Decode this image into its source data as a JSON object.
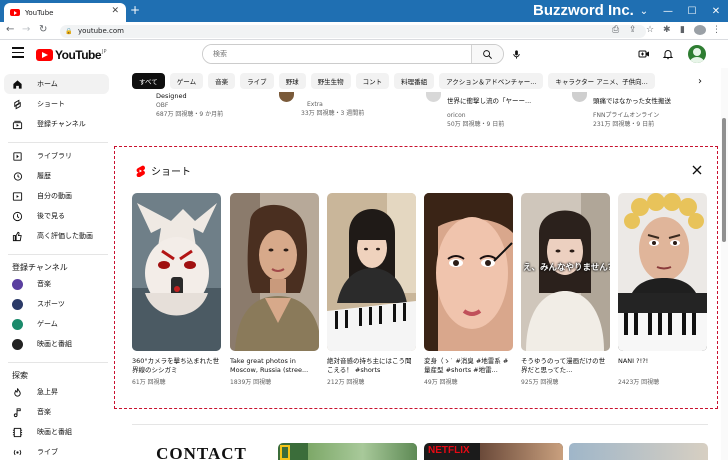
{
  "browser": {
    "tab_title": "YouTube",
    "url": "youtube.com",
    "brand_text": "Buzzword Inc."
  },
  "header": {
    "logo_text": "YouTube",
    "logo_suffix": "JP",
    "search_placeholder": "検索"
  },
  "sidebar": {
    "main": [
      {
        "label": "ホーム",
        "icon": "home-icon"
      },
      {
        "label": "ショート",
        "icon": "shorts-icon"
      },
      {
        "label": "登録チャンネル",
        "icon": "subscriptions-icon"
      }
    ],
    "library": [
      {
        "label": "ライブラリ",
        "icon": "library-icon"
      },
      {
        "label": "履歴",
        "icon": "history-icon"
      },
      {
        "label": "自分の動画",
        "icon": "my-videos-icon"
      },
      {
        "label": "後で見る",
        "icon": "watch-later-icon"
      },
      {
        "label": "高く評価した動画",
        "icon": "liked-icon"
      }
    ],
    "subs_heading": "登録チャンネル",
    "subs": [
      {
        "label": "音楽",
        "color": "#5a3fa0"
      },
      {
        "label": "スポーツ",
        "color": "#2b3a67"
      },
      {
        "label": "ゲーム",
        "color": "#1b8a6b"
      },
      {
        "label": "映画と番組",
        "color": "#222222"
      }
    ],
    "explore_heading": "探索",
    "explore": [
      {
        "label": "急上昇",
        "icon": "trending-icon"
      },
      {
        "label": "音楽",
        "icon": "music-icon"
      },
      {
        "label": "映画と番組",
        "icon": "movies-icon"
      },
      {
        "label": "ライブ",
        "icon": "live-icon"
      }
    ]
  },
  "chips": [
    "すべて",
    "ゲーム",
    "音楽",
    "ライブ",
    "野球",
    "野生生物",
    "コント",
    "料理番組",
    "アクション＆アドベンチャー...",
    "キャラクター アニメ、子供向..."
  ],
  "top_videos": [
    {
      "title": "Designed",
      "channel": "OBF",
      "stats": "687万 回視聴・9 か月前"
    },
    {
      "title": "",
      "channel": "Extra",
      "stats": "33万 回視聴・3 週間前"
    },
    {
      "title": "世界に衝撃し流の「ヤーー...",
      "channel": "oricon",
      "stats": "50万 回視聴・9 日前"
    },
    {
      "title": "頭痛ではなかった女性搬送",
      "channel": "FNNプライムオンライン",
      "stats": "231万 回視聴・9 日前"
    }
  ],
  "shorts": {
    "heading": "ショート",
    "items": [
      {
        "title": "360°カメラを擊ち込まれた世界線のシシガミ",
        "views": "61万 回視聴"
      },
      {
        "title": "Take great photos in Moscow, Russia (stree...",
        "views": "1839万 回視聴"
      },
      {
        "title": "絶対音感の持ち主にはこう聞こえる！ #shorts",
        "views": "212万 回視聴"
      },
      {
        "title": "変身（ゝ˙ #消臭 #地雷系 #量産型 #shorts #地雷...",
        "views": "49万 回視聴"
      },
      {
        "title": "そうゆうのって漫画だけの世界だと思ってた...",
        "views": "925万 回視聴",
        "overlay": "え、みんなやりません?"
      },
      {
        "title": "NANI ?!?!",
        "views": "2423万 回視聴"
      }
    ]
  },
  "bottom_row": {
    "first_label": "CONTACT",
    "third_label": "NETFLIX"
  }
}
